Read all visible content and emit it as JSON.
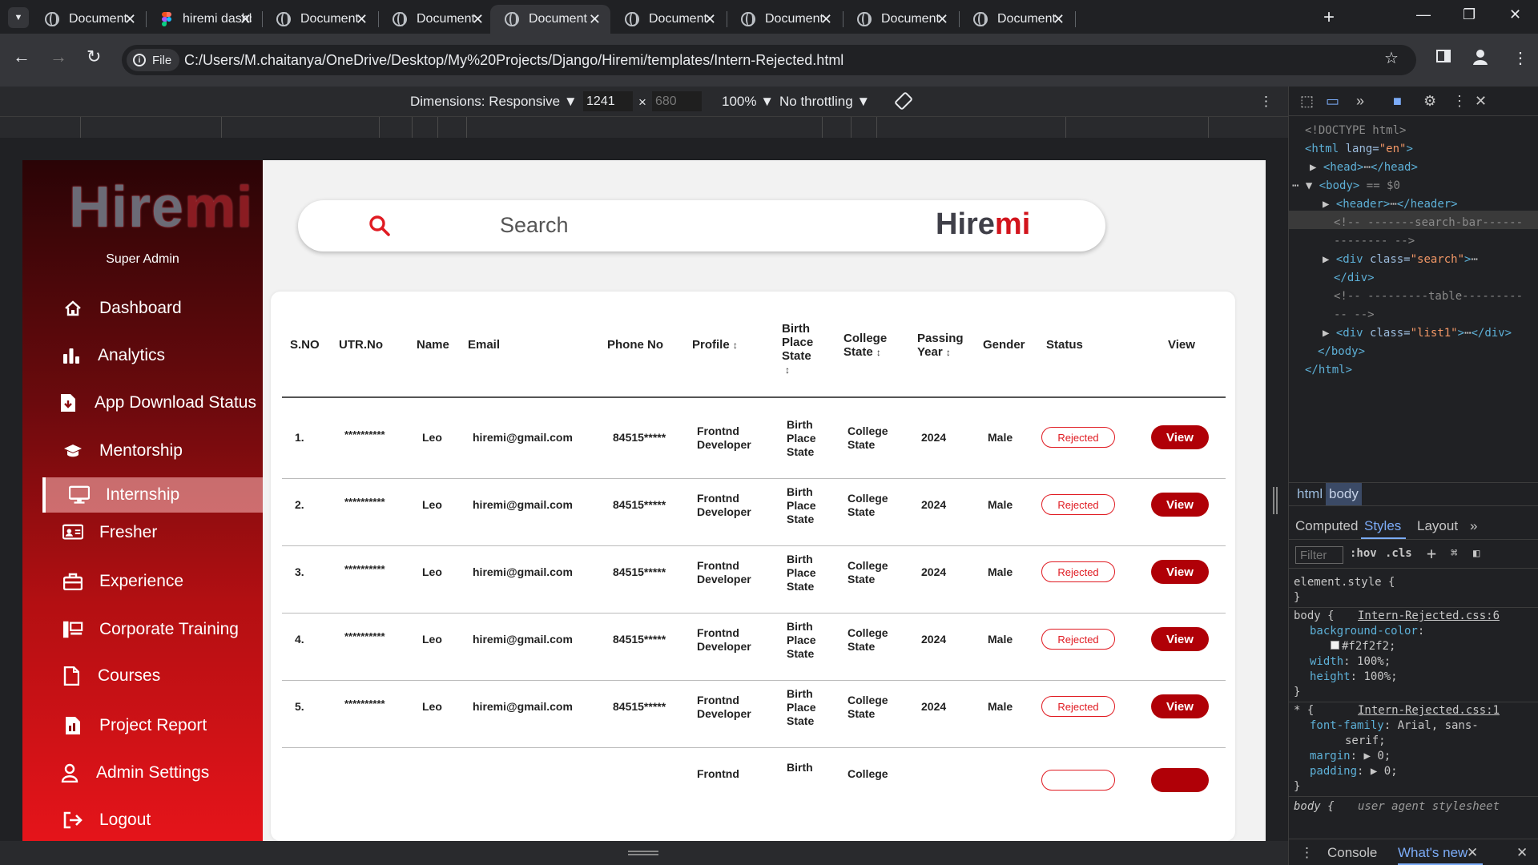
{
  "tabs": [
    {
      "title": "Document",
      "icon": "globe"
    },
    {
      "title": "hiremi dashb",
      "icon": "figma"
    },
    {
      "title": "Document",
      "icon": "globe"
    },
    {
      "title": "Document",
      "icon": "globe"
    },
    {
      "title": "Document",
      "icon": "globe",
      "active": true
    },
    {
      "title": "Document",
      "icon": "globe"
    },
    {
      "title": "Document",
      "icon": "globe"
    },
    {
      "title": "Document",
      "icon": "globe"
    },
    {
      "title": "Document",
      "icon": "globe"
    }
  ],
  "address": {
    "scheme_label": "File",
    "url": "C:/Users/M.chaitanya/OneDrive/Desktop/My%20Projects/Django/Hiremi/templates/Intern-Rejected.html"
  },
  "device_toolbar": {
    "dimensions_label": "Dimensions: Responsive",
    "width": "1241",
    "height": "680",
    "zoom": "100%",
    "throttling": "No throttling"
  },
  "app": {
    "logo_text_a": "Hire",
    "logo_text_b": "mi",
    "role": "Super Admin",
    "nav": [
      {
        "label": "Dashboard",
        "icon": "home-icon"
      },
      {
        "label": "Analytics",
        "icon": "bar-chart-icon"
      },
      {
        "label": "App Download Status",
        "icon": "download-file-icon"
      },
      {
        "label": "Mentorship",
        "icon": "graduation-cap-icon"
      },
      {
        "label": "Internship",
        "icon": "monitor-icon",
        "active": true
      },
      {
        "label": "Fresher",
        "icon": "id-card-icon"
      },
      {
        "label": "Experience",
        "icon": "briefcase-icon"
      },
      {
        "label": "Corporate Training",
        "icon": "training-board-icon"
      },
      {
        "label": "Courses",
        "icon": "document-icon"
      },
      {
        "label": "Project Report",
        "icon": "report-icon"
      },
      {
        "label": "Admin Settings",
        "icon": "user-icon"
      },
      {
        "label": "Logout",
        "icon": "logout-icon"
      }
    ],
    "search": {
      "placeholder": "Search",
      "brand_a": "Hire",
      "brand_b": "mi"
    },
    "table": {
      "headers": {
        "sno": "S.NO",
        "utr": "UTR.No",
        "name": "Name",
        "email": "Email",
        "phone": "Phone No",
        "profile": "Profile",
        "birth_1": "Birth",
        "birth_2": "Place",
        "birth_3": "State",
        "college_1": "College",
        "college_2": "State",
        "passing_1": "Passing",
        "passing_2": "Year",
        "gender": "Gender",
        "status": "Status",
        "view": "View"
      },
      "rows": [
        {
          "sno": "1.",
          "utr": "**********",
          "name": "Leo",
          "email": "hiremi@gmail.com",
          "phone": "84515*****",
          "profile_1": "Frontnd",
          "profile_2": "Developer",
          "birth_1": "Birth",
          "birth_2": "Place",
          "birth_3": "State",
          "college_1": "College",
          "college_2": "State",
          "year": "2024",
          "gender": "Male",
          "status": "Rejected",
          "action": "View"
        },
        {
          "sno": "2.",
          "utr": "**********",
          "name": "Leo",
          "email": "hiremi@gmail.com",
          "phone": "84515*****",
          "profile_1": "Frontnd",
          "profile_2": "Developer",
          "birth_1": "Birth",
          "birth_2": "Place",
          "birth_3": "State",
          "college_1": "College",
          "college_2": "State",
          "year": "2024",
          "gender": "Male",
          "status": "Rejected",
          "action": "View"
        },
        {
          "sno": "3.",
          "utr": "**********",
          "name": "Leo",
          "email": "hiremi@gmail.com",
          "phone": "84515*****",
          "profile_1": "Frontnd",
          "profile_2": "Developer",
          "birth_1": "Birth",
          "birth_2": "Place",
          "birth_3": "State",
          "college_1": "College",
          "college_2": "State",
          "year": "2024",
          "gender": "Male",
          "status": "Rejected",
          "action": "View"
        },
        {
          "sno": "4.",
          "utr": "**********",
          "name": "Leo",
          "email": "hiremi@gmail.com",
          "phone": "84515*****",
          "profile_1": "Frontnd",
          "profile_2": "Developer",
          "birth_1": "Birth",
          "birth_2": "Place",
          "birth_3": "State",
          "college_1": "College",
          "college_2": "State",
          "year": "2024",
          "gender": "Male",
          "status": "Rejected",
          "action": "View"
        },
        {
          "sno": "5.",
          "utr": "**********",
          "name": "Leo",
          "email": "hiremi@gmail.com",
          "phone": "84515*****",
          "profile_1": "Frontnd",
          "profile_2": "Developer",
          "birth_1": "Birth",
          "birth_2": "Place",
          "birth_3": "State",
          "college_1": "College",
          "college_2": "State",
          "year": "2024",
          "gender": "Male",
          "status": "Rejected",
          "action": "View"
        },
        {
          "sno": "",
          "utr": "",
          "name": "",
          "email": "",
          "phone": "",
          "profile_1": "Frontnd",
          "profile_2": "",
          "birth_1": "Birth",
          "birth_2": "",
          "birth_3": "",
          "college_1": "College",
          "college_2": "",
          "year": "",
          "gender": "",
          "status": "",
          "action": ""
        }
      ]
    }
  },
  "devtools": {
    "dom": {
      "doctype": "<!DOCTYPE html>",
      "html_open": "<html",
      "lang_attr": "lang=",
      "lang_val": "\"en\"",
      "close": ">",
      "head": "<head>",
      "head_close": "</head>",
      "ellipsis": "⋯",
      "body": "<body>",
      "body_ref": "== $0",
      "header": "<header>",
      "header_close": "</header>",
      "comment_search_1": "<!-- -------search-bar------",
      "comment_search_2": "-------- -->",
      "div_open": "<div",
      "class_attr": "class=",
      "search_val": "\"search\"",
      "div_close": "</div>",
      "comment_table_1": "<!-- ---------table---------",
      "comment_table_2": "-- -->",
      "list_val": "\"list1\"",
      "body_close": "</body>",
      "html_close": "</html>"
    },
    "breadcrumbs": [
      "html",
      "body"
    ],
    "subtabs": [
      "Computed",
      "Styles",
      "Layout"
    ],
    "filter_placeholder": "Filter",
    "filter_hov": ":hov",
    "filter_cls": ".cls",
    "styles": {
      "element_style": "element.style {",
      "brace_close": "}",
      "body_sel": "body {",
      "body_src": "Intern-Rejected.css:6",
      "bg_prop": "background-color",
      "bg_val": "#f2f2f2;",
      "width_prop": "width",
      "width_val": "100%;",
      "height_prop": "height",
      "height_val": "100%;",
      "star_sel": "* {",
      "star_src": "Intern-Rejected.css:1",
      "ff_prop": "font-family",
      "ff_val_1": "Arial, sans-",
      "ff_val_2": "serif;",
      "margin_prop": "margin",
      "margin_val": "0;",
      "padding_prop": "padding",
      "padding_val": "0;",
      "ua_sel": "body {",
      "ua_src": "user agent stylesheet"
    },
    "drawer_tabs": [
      "Console",
      "What's new"
    ]
  }
}
